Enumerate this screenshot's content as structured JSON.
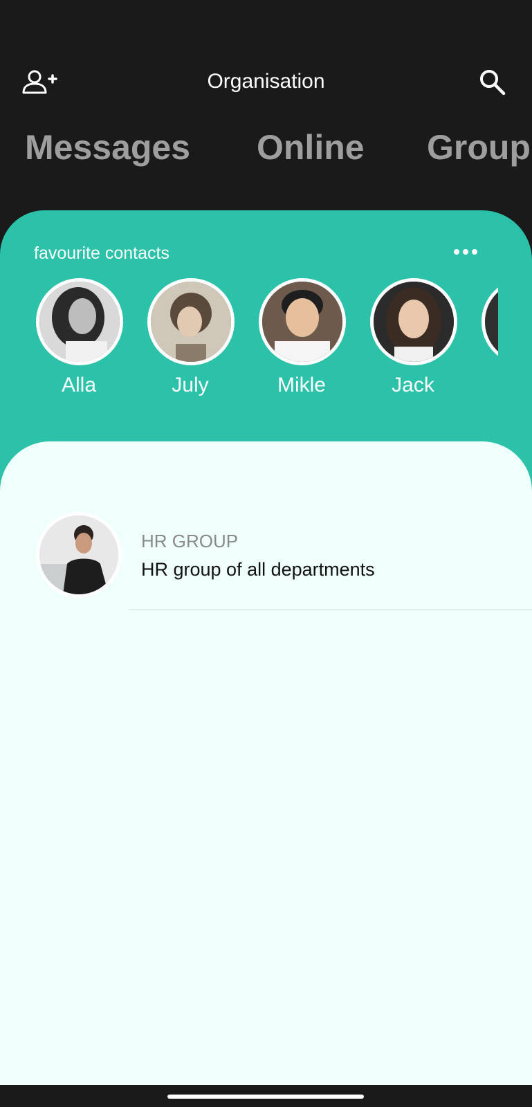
{
  "header": {
    "title": "Organisation",
    "add_user_icon": "add-user-icon",
    "search_icon": "search-icon"
  },
  "tabs": [
    {
      "label": "Messages"
    },
    {
      "label": "Online"
    },
    {
      "label": "Group"
    }
  ],
  "favourites": {
    "label": "favourite contacts",
    "more_icon": "more-horizontal-icon",
    "contacts": [
      {
        "name": "Alla"
      },
      {
        "name": "July"
      },
      {
        "name": "Mikle"
      },
      {
        "name": "Jack"
      }
    ]
  },
  "list": {
    "items": [
      {
        "title": "HR GROUP",
        "subtitle": "HR group of all departments"
      }
    ]
  },
  "colors": {
    "background": "#1a1a1a",
    "accent": "#2bc2a9",
    "list_background": "#effffb",
    "tab_text": "#9e9e9e"
  }
}
